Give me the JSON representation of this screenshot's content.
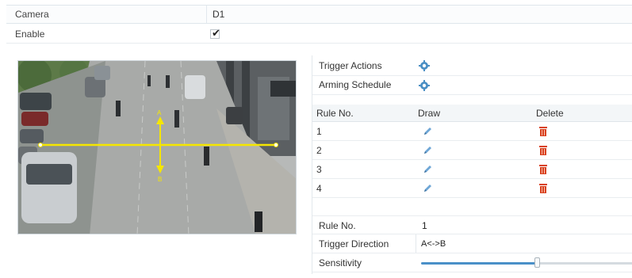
{
  "form": {
    "camera_label": "Camera",
    "camera_value": "D1",
    "enable_label": "Enable",
    "enable_checked": true,
    "enable_checkmark": "✔"
  },
  "video": {
    "line_label_a": "A",
    "line_label_b": "B"
  },
  "panel": {
    "trigger_actions_label": "Trigger Actions",
    "arming_schedule_label": "Arming Schedule",
    "rule_table": {
      "headers": {
        "rule_no": "Rule No.",
        "draw": "Draw",
        "delete": "Delete"
      },
      "rows": [
        {
          "rule_no": "1"
        },
        {
          "rule_no": "2"
        },
        {
          "rule_no": "3"
        },
        {
          "rule_no": "4"
        }
      ]
    },
    "rule_no_label": "Rule No.",
    "rule_no_value": "1",
    "trigger_direction_label": "Trigger Direction",
    "trigger_direction_value": "A<->B",
    "sensitivity_label": "Sensitivity",
    "sensitivity_fraction": 0.54
  },
  "colors": {
    "accent": "#4a90c8",
    "line": "#f5e600",
    "delete": "#d9411e",
    "gear": "#4a8fc4"
  }
}
